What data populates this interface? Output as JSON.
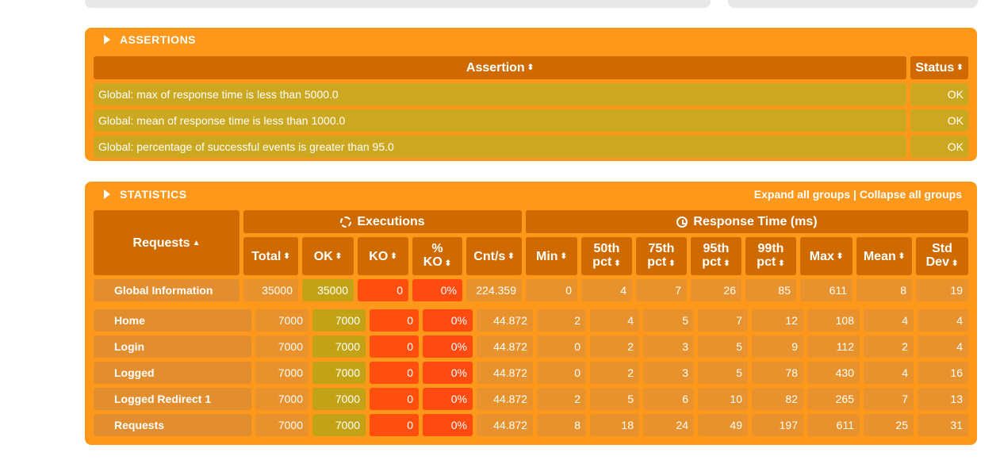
{
  "assertions": {
    "title": "ASSERTIONS",
    "header_assertion": "Assertion",
    "header_status": "Status",
    "rows": [
      {
        "text": "Global: max of response time is less than 5000.0",
        "status": "OK"
      },
      {
        "text": "Global: mean of response time is less than 1000.0",
        "status": "OK"
      },
      {
        "text": "Global: percentage of successful events is greater than 95.0",
        "status": "OK"
      }
    ]
  },
  "statistics": {
    "title": "STATISTICS",
    "expand_all": "Expand all groups",
    "separator": " | ",
    "collapse_all": "Collapse all groups",
    "requests_header": "Requests",
    "executions_header": "Executions",
    "response_time_header": "Response Time (ms)",
    "col_total": "Total",
    "col_ok": "OK",
    "col_ko": "KO",
    "col_pko_1": "%",
    "col_pko_2": "KO",
    "col_cnts": "Cnt/s",
    "col_min": "Min",
    "col_p50_1": "50th",
    "col_p50_2": "pct",
    "col_p75_1": "75th",
    "col_p75_2": "pct",
    "col_p95_1": "95th",
    "col_p95_2": "pct",
    "col_p99_1": "99th",
    "col_p99_2": "pct",
    "col_max": "Max",
    "col_mean": "Mean",
    "col_std_1": "Std",
    "col_std_2": "Dev",
    "global": {
      "label": "Global Information",
      "total": "35000",
      "ok": "35000",
      "ko": "0",
      "pko": "0%",
      "cnts": "224.359",
      "min": "0",
      "p50": "4",
      "p75": "7",
      "p95": "26",
      "p99": "85",
      "max": "611",
      "mean": "8",
      "std": "19"
    },
    "rows": [
      {
        "label": "Home",
        "total": "7000",
        "ok": "7000",
        "ko": "0",
        "pko": "0%",
        "cnts": "44.872",
        "min": "2",
        "p50": "4",
        "p75": "5",
        "p95": "7",
        "p99": "12",
        "max": "108",
        "mean": "4",
        "std": "4"
      },
      {
        "label": "Login",
        "total": "7000",
        "ok": "7000",
        "ko": "0",
        "pko": "0%",
        "cnts": "44.872",
        "min": "0",
        "p50": "2",
        "p75": "3",
        "p95": "5",
        "p99": "9",
        "max": "112",
        "mean": "2",
        "std": "4"
      },
      {
        "label": "Logged",
        "total": "7000",
        "ok": "7000",
        "ko": "0",
        "pko": "0%",
        "cnts": "44.872",
        "min": "0",
        "p50": "2",
        "p75": "3",
        "p95": "5",
        "p99": "78",
        "max": "430",
        "mean": "4",
        "std": "16"
      },
      {
        "label": "Logged Redirect 1",
        "total": "7000",
        "ok": "7000",
        "ko": "0",
        "pko": "0%",
        "cnts": "44.872",
        "min": "2",
        "p50": "5",
        "p75": "6",
        "p95": "10",
        "p99": "82",
        "max": "265",
        "mean": "7",
        "std": "13"
      },
      {
        "label": "Requests",
        "total": "7000",
        "ok": "7000",
        "ko": "0",
        "pko": "0%",
        "cnts": "44.872",
        "min": "8",
        "p50": "18",
        "p75": "24",
        "p95": "49",
        "p99": "197",
        "max": "611",
        "mean": "25",
        "std": "31"
      }
    ]
  },
  "icons": {
    "sort": "sort-icon",
    "sort_asc": "sort-asc-icon",
    "executions": "refresh-icon",
    "response_time": "clock-icon"
  },
  "colors": {
    "panel": "#fe981b",
    "header": "#ce6a00",
    "ok": "#c3a316",
    "ko": "#ff4f0f"
  }
}
